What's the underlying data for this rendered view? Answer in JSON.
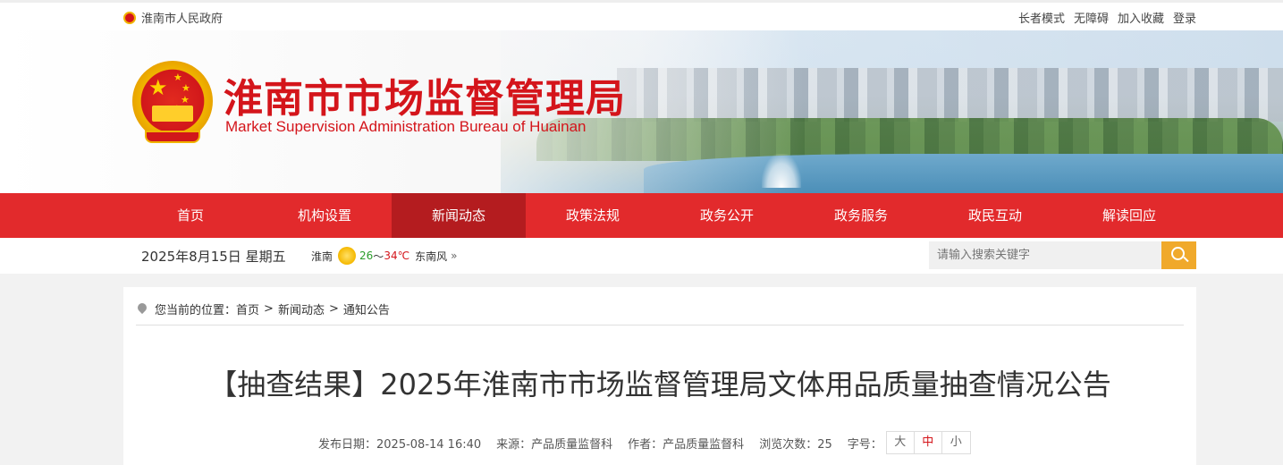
{
  "topbar": {
    "gov_link": "淮南市人民政府",
    "links": [
      "长者模式",
      "无障碍",
      "加入收藏",
      "登录"
    ]
  },
  "header": {
    "title_cn": "淮南市市场监督管理局",
    "title_en": "Market Supervision Administration Bureau of Huainan"
  },
  "nav": {
    "items": [
      "首页",
      "机构设置",
      "新闻动态",
      "政策法规",
      "政务公开",
      "政务服务",
      "政民互动",
      "解读回应"
    ],
    "active": "新闻动态"
  },
  "infobar": {
    "date": "2025年8月15日  星期五",
    "city": "淮南",
    "temp_low": "26",
    "temp_sep": "～",
    "temp_high": "34℃",
    "wind": "东南风",
    "more": "»",
    "weather_icon": "sun-icon"
  },
  "search": {
    "placeholder": "请输入搜索关键字"
  },
  "breadcrumb": {
    "prefix": "您当前的位置：",
    "items": [
      "首页",
      "新闻动态",
      "通知公告"
    ],
    "separator": ">"
  },
  "article": {
    "title": "【抽查结果】2025年淮南市市场监督管理局文体用品质量抽查情况公告",
    "publish": "发布日期：2025-08-14 16:40",
    "source": "来源：产品质量监督科",
    "author": "作者：产品质量监督科",
    "views": "浏览次数：25",
    "fontsize_label": "字号：",
    "fontsize_options": [
      "大",
      "中",
      "小"
    ],
    "fontsize_active": "中"
  },
  "colors": {
    "brand_red": "#d4151b",
    "nav_bg": "#e22a2c",
    "nav_active": "#b41c1f",
    "search_btn": "#f0a92b"
  }
}
